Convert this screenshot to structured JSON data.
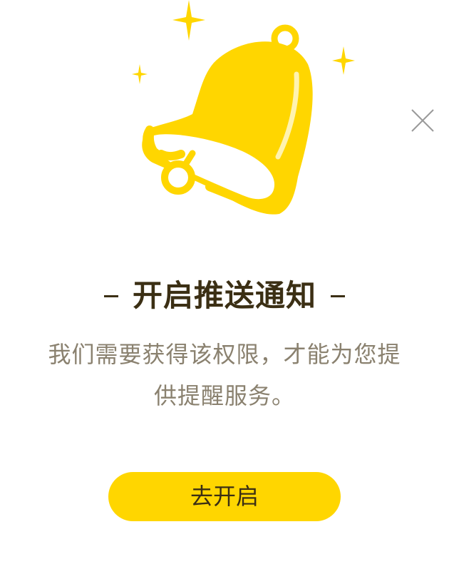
{
  "dialog": {
    "title": "开启推送通知",
    "description": "我们需要获得该权限，才能为您提供提醒服务。",
    "enable_button_label": "去开启"
  },
  "icons": {
    "illustration": "bell-icon",
    "close": "close-icon"
  },
  "colors": {
    "accent": "#ffd600",
    "title_text": "#3b2f14",
    "body_text": "#8a816f",
    "close_icon": "#9a9a9a"
  }
}
